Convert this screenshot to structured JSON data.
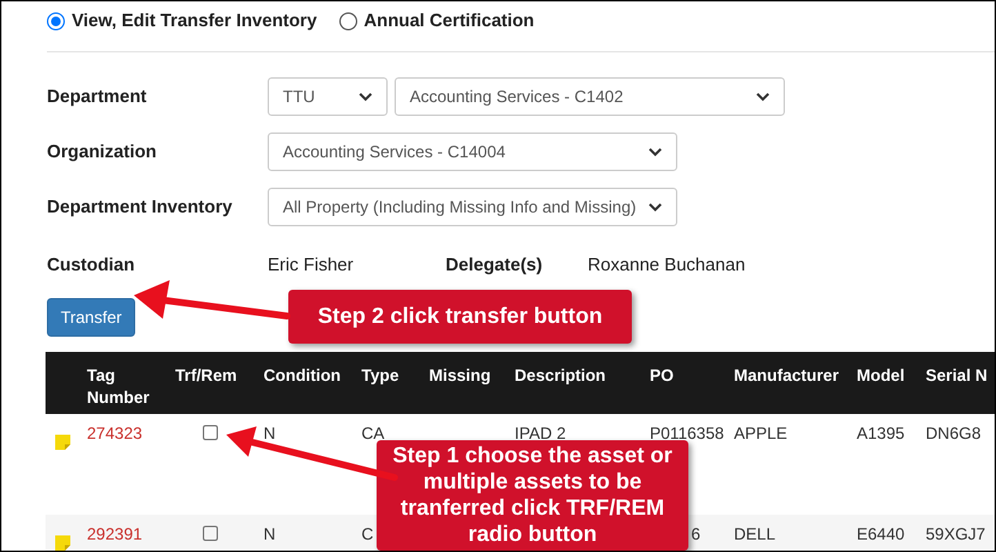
{
  "view_options": [
    {
      "label": "View, Edit Transfer Inventory",
      "selected": true
    },
    {
      "label": "Annual Certification",
      "selected": false
    }
  ],
  "fields": [
    {
      "label": "Department",
      "selects": [
        "TTU",
        "Accounting Services - C1402"
      ]
    },
    {
      "label": "Organization",
      "selects": [
        "Accounting Services - C14004"
      ]
    },
    {
      "label": "Department Inventory",
      "selects": [
        "All Property (Including Missing Info and Missing)"
      ]
    }
  ],
  "custodian": {
    "label": "Custodian",
    "value": "Eric Fisher"
  },
  "delegates": {
    "label": "Delegate(s)",
    "value": "Roxanne Buchanan"
  },
  "transfer_button": "Transfer",
  "table": {
    "columns": [
      "Tag Number",
      "Trf/Rem",
      "Condition",
      "Type",
      "Missing",
      "Description",
      "PO",
      "Manufacturer",
      "Model",
      "Serial N"
    ],
    "rows": [
      {
        "trf_rem_checked": false,
        "cells": [
          "274323",
          null,
          "N",
          "CA",
          null,
          "IPAD 2",
          "P0116358",
          "APPLE",
          "A1395",
          "DN6G8"
        ]
      },
      {
        "trf_rem_checked": false,
        "cells": [
          "292391",
          null,
          "N",
          "C",
          null,
          null,
          "6",
          "DELL",
          "E6440",
          "59XGJ7"
        ]
      }
    ]
  },
  "annotations": [
    {
      "text": "Step 2 click transfer button"
    },
    {
      "text": "Step 1 choose the asset or multiple assets to be tranferred click TRF/REM radio button"
    }
  ]
}
